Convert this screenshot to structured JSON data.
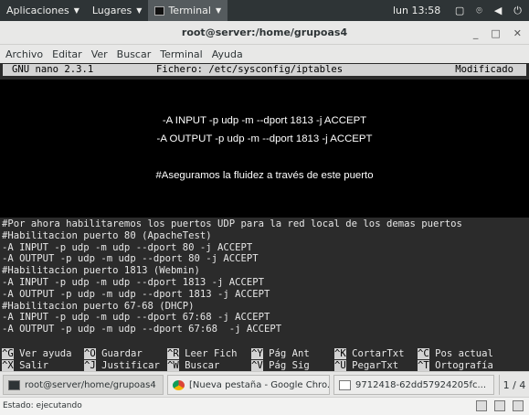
{
  "topbar": {
    "applications": "Aplicaciones",
    "places": "Lugares",
    "active_app": "Terminal",
    "clock": "lun 13:58",
    "icons": [
      "window-icon",
      "network-icon",
      "volume-icon",
      "power-icon"
    ]
  },
  "window": {
    "title": "root@server:/home/grupoas4",
    "controls": [
      "minimize-icon",
      "maximize-icon",
      "close-icon"
    ]
  },
  "menu": [
    "Archivo",
    "Editar",
    "Ver",
    "Buscar",
    "Terminal",
    "Ayuda"
  ],
  "nano": {
    "version": "GNU nano 2.3.1",
    "file": "Fichero: /etc/sysconfig/iptables",
    "status": "Modificado"
  },
  "overlay": {
    "line1": "-A INPUT -p udp -m --dport 1813 -j ACCEPT",
    "line2": "-A OUTPUT -p udp -m --dport 1813 -j ACCEPT",
    "line3": "#Aseguramos la fluidez a través de este puerto"
  },
  "code_lines": [
    "#Por ahora habilitaremos los puertos UDP para la red local de los demas puertos",
    "#Habilitacion puerto 80 (ApacheTest)",
    "-A INPUT -p udp -m udp --dport 80 -j ACCEPT",
    "-A OUTPUT -p udp -m udp --dport 80 -j ACCEPT",
    "#Habilitacion puerto 1813 (Webmin)",
    "-A INPUT -p udp -m udp --dport 1813 -j ACCEPT",
    "-A OUTPUT -p udp -m udp --dport 1813 -j ACCEPT",
    "#Habilitacion puerto 67-68 (DHCP)",
    "-A INPUT -p udp -m udp --dport 67:68 -j ACCEPT",
    "-A OUTPUT -p udp -m udp --dport 67:68  -j ACCEPT"
  ],
  "shortcuts": {
    "row1": [
      {
        "key": "^G",
        "label": "Ver ayuda"
      },
      {
        "key": "^O",
        "label": "Guardar"
      },
      {
        "key": "^R",
        "label": "Leer Fich"
      },
      {
        "key": "^Y",
        "label": "Pág Ant"
      },
      {
        "key": "^K",
        "label": "CortarTxt"
      },
      {
        "key": "^C",
        "label": "Pos actual"
      }
    ],
    "row2": [
      {
        "key": "^X",
        "label": "Salir"
      },
      {
        "key": "^J",
        "label": "Justificar"
      },
      {
        "key": "^W",
        "label": "Buscar"
      },
      {
        "key": "^V",
        "label": "Pág Sig"
      },
      {
        "key": "^U",
        "label": "PegarTxt"
      },
      {
        "key": "^T",
        "label": "Ortografía"
      }
    ]
  },
  "taskbar": {
    "tasks": [
      "root@server/home/grupoas4",
      "[Nueva pestaña - Google Chro...",
      "9712418-62dd57924205fc..."
    ],
    "pager": "1 / 4"
  },
  "status": {
    "text": "Estado: ejecutando"
  }
}
